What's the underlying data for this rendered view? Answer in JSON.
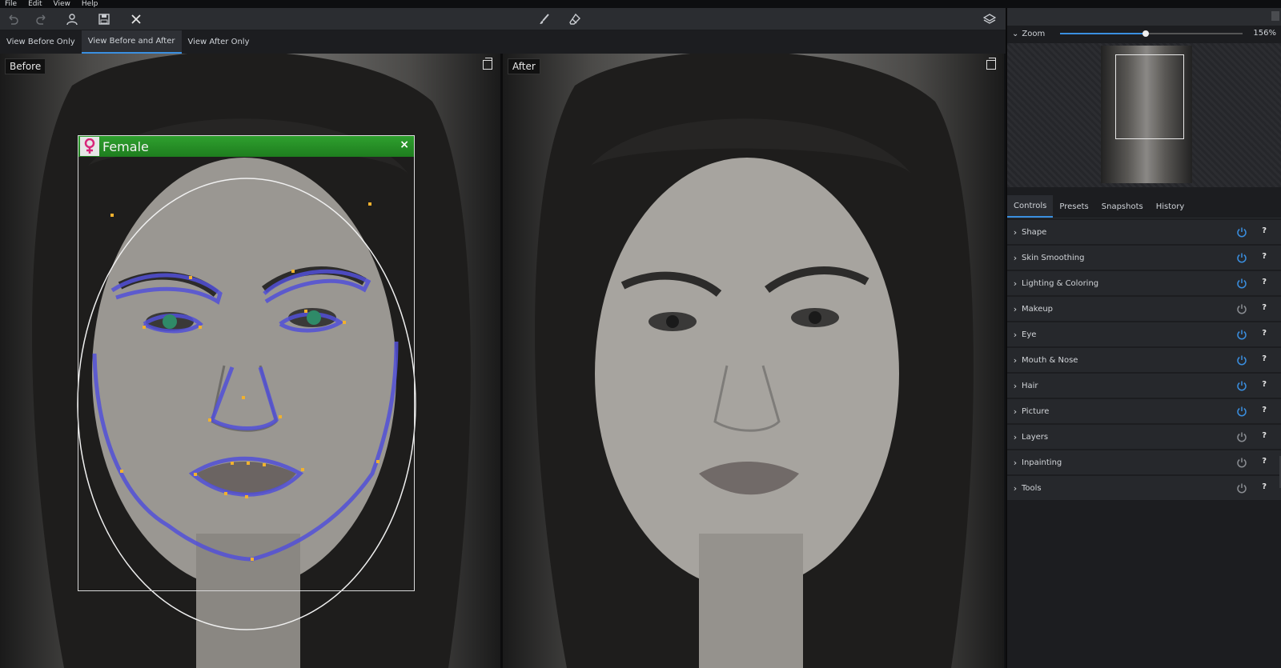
{
  "menu": [
    "File",
    "Edit",
    "View",
    "Help"
  ],
  "toolbar": {
    "icons": [
      "undo-icon",
      "redo-icon",
      "face-icon",
      "save-icon",
      "close-icon",
      "brush-icon",
      "eraser-icon",
      "layers-icon"
    ]
  },
  "view_tabs": [
    {
      "label": "View Before Only",
      "active": false
    },
    {
      "label": "View Before and After",
      "active": true
    },
    {
      "label": "View After Only",
      "active": false
    }
  ],
  "panes": {
    "before_label": "Before",
    "after_label": "After",
    "face_label": "Female",
    "face_close": "×"
  },
  "right_panel": {
    "zoom_label": "Zoom",
    "zoom_value": "156%",
    "zoom_fraction": 0.47,
    "tabs": [
      {
        "label": "Controls",
        "active": true
      },
      {
        "label": "Presets",
        "active": false
      },
      {
        "label": "Snapshots",
        "active": false
      },
      {
        "label": "History",
        "active": false
      }
    ],
    "controls": [
      {
        "label": "Shape",
        "enabled": true
      },
      {
        "label": "Skin Smoothing",
        "enabled": true
      },
      {
        "label": "Lighting & Coloring",
        "enabled": true
      },
      {
        "label": "Makeup",
        "enabled": false
      },
      {
        "label": "Eye",
        "enabled": true
      },
      {
        "label": "Mouth & Nose",
        "enabled": true
      },
      {
        "label": "Hair",
        "enabled": true
      },
      {
        "label": "Picture",
        "enabled": true
      },
      {
        "label": "Layers",
        "enabled": false
      },
      {
        "label": "Inpainting",
        "enabled": false
      },
      {
        "label": "Tools",
        "enabled": false
      }
    ],
    "help_label": "?"
  },
  "colors": {
    "accent": "#3a8fe0",
    "power_on": "#3a8fe0",
    "power_off": "#8a8d92",
    "face_header": "#2fa02f"
  }
}
